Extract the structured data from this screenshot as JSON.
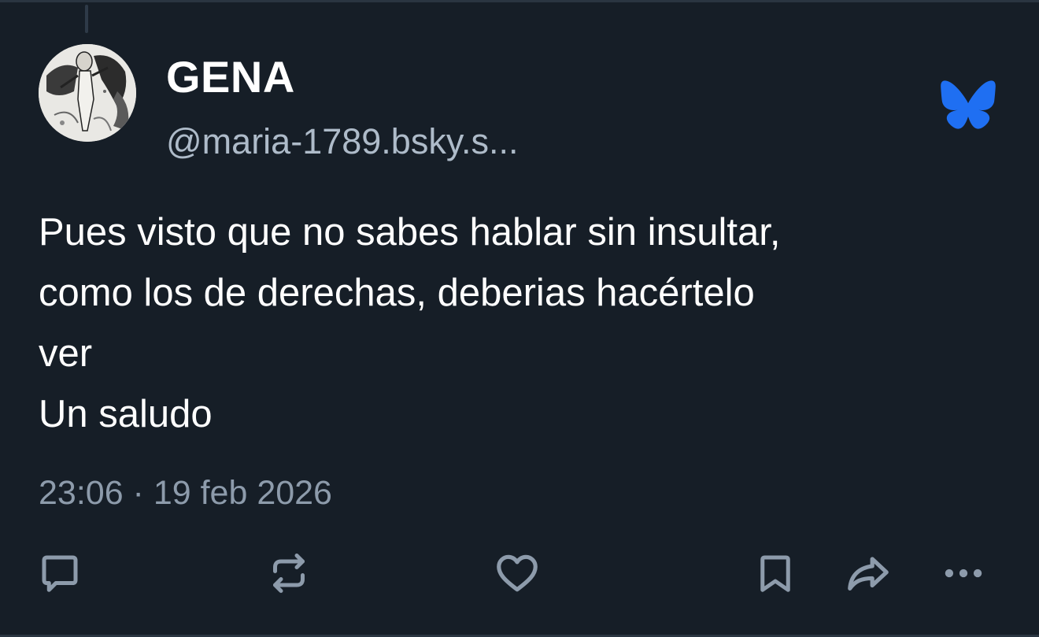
{
  "post": {
    "author_name": "GENA",
    "author_handle": "@maria-1789.bsky.s...",
    "text": "Pues visto que no sabes hablar sin insultar,\ncomo los de derechas, deberias hacértelo\nver\nUn saludo",
    "timestamp": "23:06 · 19 feb 2026"
  },
  "icons": {
    "brand": "bluesky-butterfly-icon",
    "reply": "comment-bubble-icon",
    "repost": "repost-arrows-icon",
    "like": "heart-icon",
    "bookmark": "bookmark-icon",
    "share": "share-arrow-icon",
    "more": "ellipsis-icon"
  },
  "colors": {
    "background": "#161e27",
    "text": "#ffffff",
    "handle": "#aebbc9",
    "timestamp": "#8d9bab",
    "icon": "#8d9bab",
    "brand": "#1f6ff2"
  }
}
